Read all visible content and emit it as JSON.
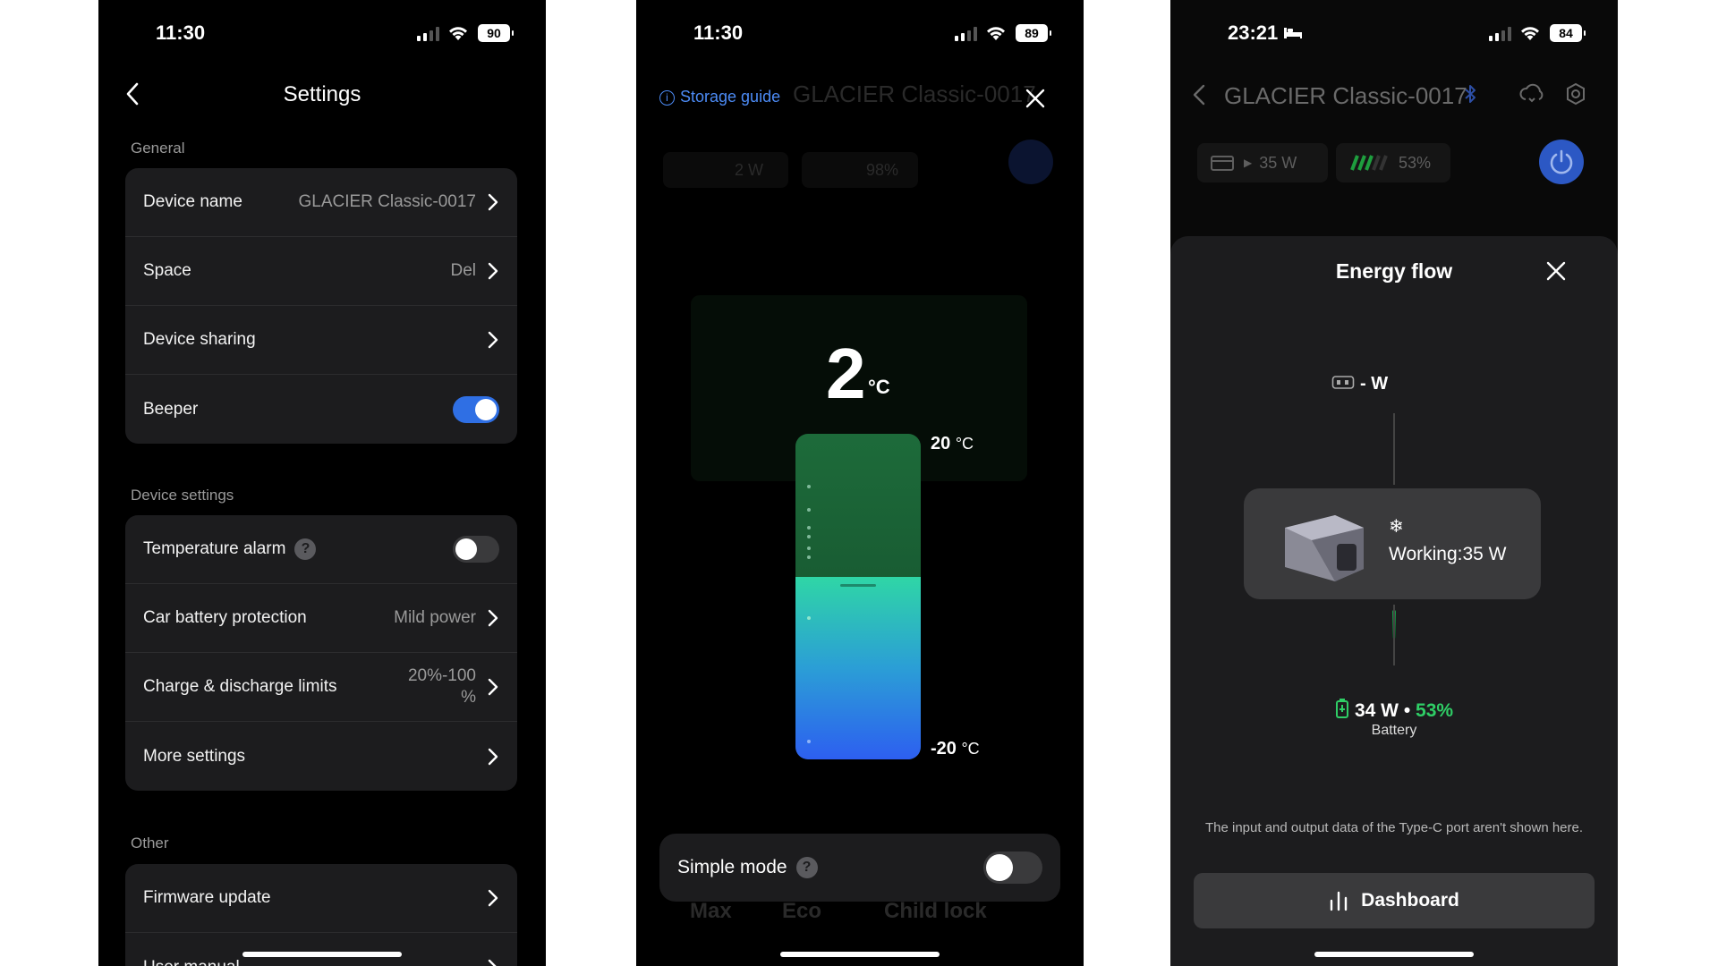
{
  "screen1": {
    "status": {
      "time": "11:30",
      "battery": "90"
    },
    "title": "Settings",
    "general": {
      "label": "General",
      "device_name_label": "Device name",
      "device_name_value": "GLACIER Classic-0017",
      "space_label": "Space",
      "space_value": "Del",
      "sharing_label": "Device sharing",
      "beeper_label": "Beeper",
      "beeper_on": true
    },
    "device_settings": {
      "label": "Device settings",
      "temp_alarm_label": "Temperature alarm",
      "temp_alarm_on": false,
      "car_batt_label": "Car battery protection",
      "car_batt_value": "Mild power",
      "limits_label": "Charge & discharge limits",
      "limits_value_line1": "20%-100",
      "limits_value_line2": "%",
      "more_label": "More settings"
    },
    "other": {
      "label": "Other",
      "firmware_label": "Firmware update",
      "manual_label": "User manual"
    }
  },
  "screen2": {
    "status": {
      "time": "11:30",
      "battery": "89"
    },
    "storage_guide": "Storage guide",
    "bg_title": "GLACIER Classic-0017",
    "bg_input": "2 W",
    "bg_battery": "98%",
    "bg_modes": [
      "Max",
      "Eco",
      "Child lock"
    ],
    "current_temp": "2",
    "temp_unit": "°C",
    "max_temp": "20",
    "min_temp": "-20",
    "unit_small": "°C",
    "fill_fraction": 0.56,
    "simple_mode_label": "Simple mode",
    "simple_mode_on": false
  },
  "screen3": {
    "status": {
      "time": "23:21",
      "battery": "84"
    },
    "title": "GLACIER Classic-0017",
    "input_power": "35 W",
    "battery_pill": "53%",
    "sheet_title": "Energy flow",
    "input_w": "- W",
    "working": "Working:35 W",
    "battery_power": "34 W",
    "battery_sep": "•",
    "battery_pct": "53%",
    "battery_label": "Battery",
    "note": "The input and output data of the Type-C port aren't shown here.",
    "dashboard": "Dashboard",
    "accent_green": "#2fce66",
    "accent_blue": "#2f6fe4"
  }
}
